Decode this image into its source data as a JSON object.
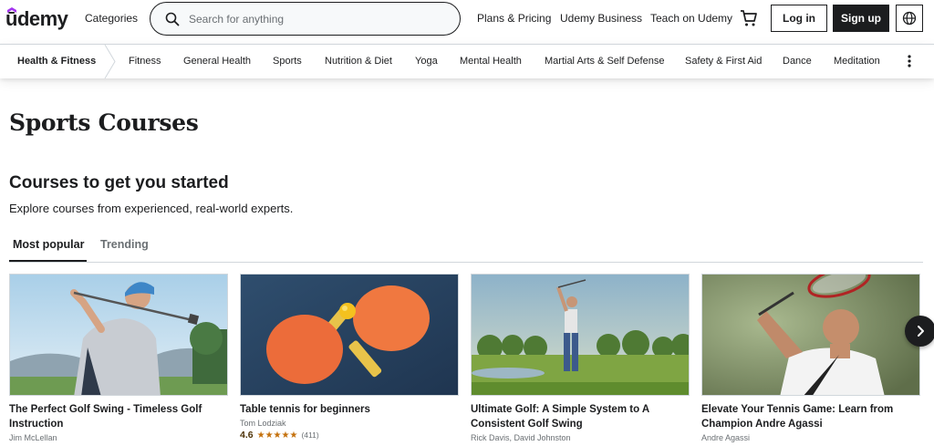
{
  "header": {
    "logo": "ūdemy",
    "categories_label": "Categories",
    "search_placeholder": "Search for anything",
    "plans_label": "Plans & Pricing",
    "business_label": "Udemy Business",
    "teach_label": "Teach on Udemy",
    "login_label": "Log in",
    "signup_label": "Sign up",
    "brand_color": "#a435f0"
  },
  "catbar": {
    "current": "Health & Fitness",
    "items": [
      "Fitness",
      "General Health",
      "Sports",
      "Nutrition & Diet",
      "Yoga",
      "Mental Health",
      "Martial Arts & Self Defense",
      "Safety & First Aid",
      "Dance",
      "Meditation"
    ]
  },
  "main": {
    "title": "Sports Courses",
    "section_title": "Courses to get you started",
    "section_subtitle": "Explore courses from experienced, real-world experts.",
    "tabs": [
      {
        "label": "Most popular",
        "active": true
      },
      {
        "label": "Trending",
        "active": false
      }
    ]
  },
  "courses": [
    {
      "title": "The Perfect Golf Swing - Timeless Golf Instruction",
      "author": "Jim McLellan",
      "thumbnail": "golfer-swing-photo"
    },
    {
      "title": "Table tennis for beginners",
      "author": "Tom Lodziak",
      "rating": "4.6",
      "stars": "★★★★★",
      "rating_count": "(411)",
      "thumbnail": "ping-pong-paddles-photo"
    },
    {
      "title": "Ultimate Golf: A Simple System to A Consistent Golf Swing",
      "author": "Rick Davis, David Johnston",
      "thumbnail": "golf-course-photo"
    },
    {
      "title": "Elevate Your Tennis Game: Learn from Champion Andre Agassi",
      "author": "Andre Agassi",
      "thumbnail": "tennis-player-photo"
    }
  ],
  "colors": {
    "text": "#1c1d1f",
    "muted": "#6a6f73",
    "star": "#c4710d",
    "rating": "#4d3105"
  }
}
